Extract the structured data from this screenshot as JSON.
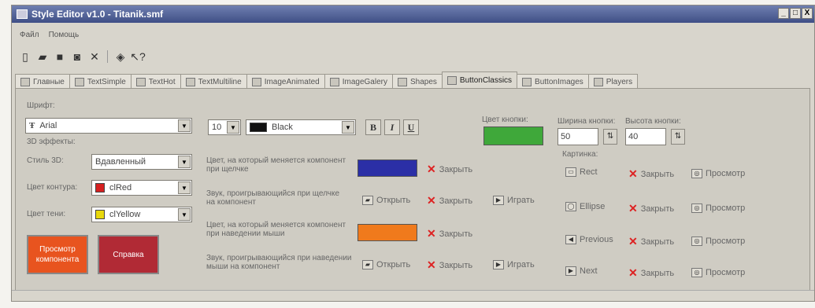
{
  "window": {
    "title": "Style Editor v1.0 - Titanik.smf",
    "controls": [
      "_",
      "□",
      "X"
    ]
  },
  "menu": [
    "Файл",
    "Помощь"
  ],
  "toolbar": {
    "icons": [
      "new-file-icon",
      "open-folder-icon",
      "save-icon",
      "save-all-icon",
      "close-icon",
      "style-icon",
      "help-icon"
    ]
  },
  "tabs": [
    "Главные",
    "TextSimple",
    "TextHot",
    "TextMultiline",
    "ImageAnimated",
    "ImageGalery",
    "Shapes",
    "ButtonClassics",
    "ButtonImages",
    "Players"
  ],
  "active_tab": "ButtonClassics",
  "font": {
    "label": "Шрифт:",
    "name": "Arial",
    "size": "10",
    "color_name": "Black",
    "bold": "B",
    "italic": "I",
    "underline": "U"
  },
  "effects": {
    "label": "3D эффекты:",
    "style_label": "Стиль 3D:",
    "style_value": "Вдавленный",
    "contour_label": "Цвет контура:",
    "contour_value": "clRed",
    "shadow_label": "Цвет тени:",
    "shadow_value": "clYellow"
  },
  "buttons": {
    "preview": "Просмотр компонента",
    "help": "Справка"
  },
  "rows": [
    {
      "label": "Цвет, на который меняется компонент при щелчке",
      "type": "color"
    },
    {
      "label": "Звук, проигрывающийся при щелчке на компонент",
      "type": "sound"
    },
    {
      "label": "Цвет, на который меняется компонент при наведении мыши",
      "type": "color"
    },
    {
      "label": "Звук, проигрывающийся при наведении мыши на компонент",
      "type": "sound"
    }
  ],
  "actions": {
    "close": "Закрыть",
    "open": "Открыть",
    "play": "Играть",
    "view": "Просмотр"
  },
  "button_color": {
    "label": "Цвет кнопки:"
  },
  "button_size": {
    "width_label": "Ширина кнопки:",
    "width_value": "50",
    "height_label": "Высота кнопки:",
    "height_value": "40"
  },
  "picture": {
    "label": "Картинка:",
    "items": [
      "Rect",
      "Ellipse",
      "Previous",
      "Next"
    ]
  },
  "colors": {
    "row1": "#2b2fa6",
    "row3": "#f07a1c",
    "button": "#3fa83a",
    "preview_btn": "#e8541f",
    "help_btn": "#b12a35",
    "contour": "#d62020",
    "shadow": "#e8d80c",
    "black": "#111111"
  }
}
